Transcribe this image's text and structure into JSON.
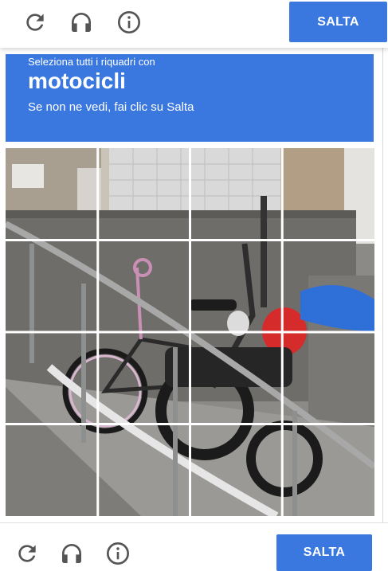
{
  "top_bar": {
    "reload_icon": "reload-icon",
    "audio_icon": "headphones-icon",
    "info_icon": "info-icon",
    "skip_label": "SALTA"
  },
  "header": {
    "instruction": "Seleziona tutti i riquadri con",
    "target": "motocicli",
    "hint": "Se non ne vedi, fai clic su Salta"
  },
  "grid": {
    "rows": 4,
    "cols": 4,
    "tiles": [
      "1-1",
      "1-2",
      "1-3",
      "1-4",
      "2-1",
      "2-2",
      "2-3",
      "2-4",
      "3-1",
      "3-2",
      "3-3",
      "3-4",
      "4-1",
      "4-2",
      "4-3",
      "4-4"
    ]
  },
  "bottom_bar": {
    "reload_icon": "reload-icon",
    "audio_icon": "headphones-icon",
    "info_icon": "info-icon",
    "skip_label": "SALTA"
  },
  "colors": {
    "accent": "#3a78e0",
    "icon": "#555555"
  }
}
